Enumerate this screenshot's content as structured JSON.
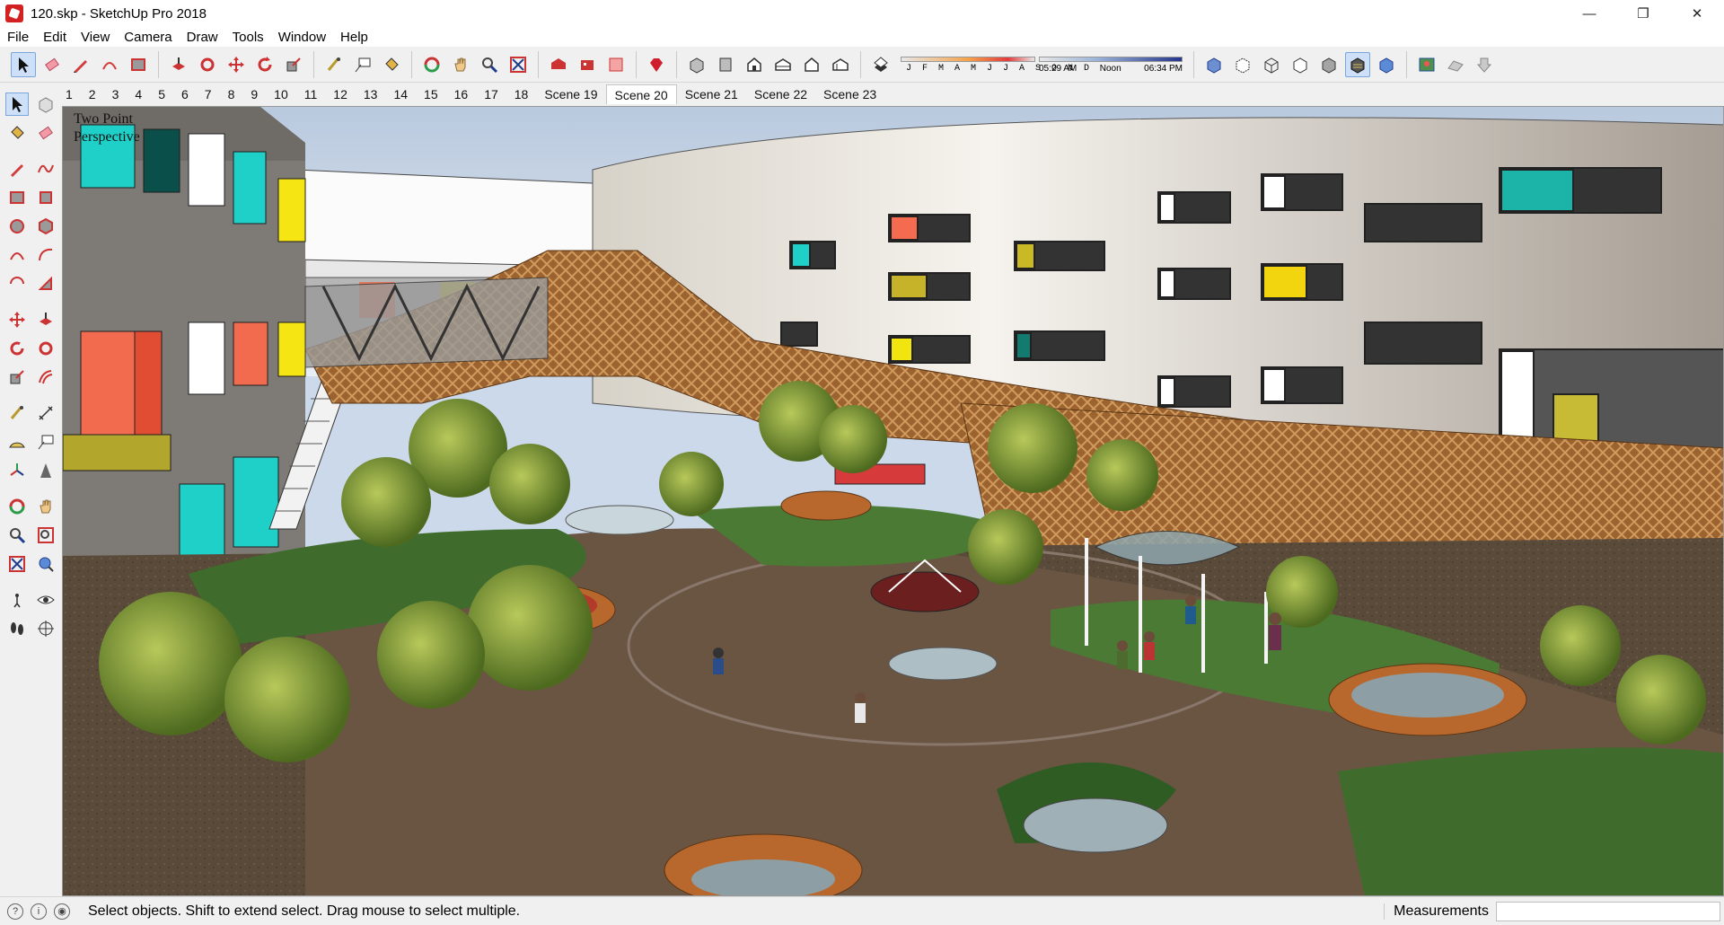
{
  "window": {
    "title": "120.skp - SketchUp Pro 2018",
    "min_glyph": "—",
    "max_glyph": "❐",
    "close_glyph": "✕"
  },
  "menu": [
    "File",
    "Edit",
    "View",
    "Camera",
    "Draw",
    "Tools",
    "Window",
    "Help"
  ],
  "shadow": {
    "months": "J F M A M J J A S O N D",
    "time_start": "05:29 AM",
    "time_mid": "Noon",
    "time_end": "06:34 PM"
  },
  "scenes": {
    "tabs": [
      "1",
      "2",
      "3",
      "4",
      "5",
      "6",
      "7",
      "8",
      "9",
      "10",
      "11",
      "12",
      "13",
      "14",
      "15",
      "16",
      "17",
      "18",
      "Scene 19",
      "Scene 20",
      "Scene 21",
      "Scene 22",
      "Scene 23"
    ],
    "active": "Scene 20"
  },
  "viewport": {
    "camera_label_line1": "Two Point",
    "camera_label_line2": "Perspective"
  },
  "status": {
    "hint": "Select objects. Shift to extend select. Drag mouse to select multiple.",
    "measurements_label": "Measurements",
    "measurements_value": ""
  },
  "colors": {
    "accent_select": "#cde0f7",
    "facade_teal": "#1fd0c8",
    "facade_yellow": "#f5e512",
    "facade_coral": "#f36b4e",
    "bridge_rust": "#a86a33"
  }
}
